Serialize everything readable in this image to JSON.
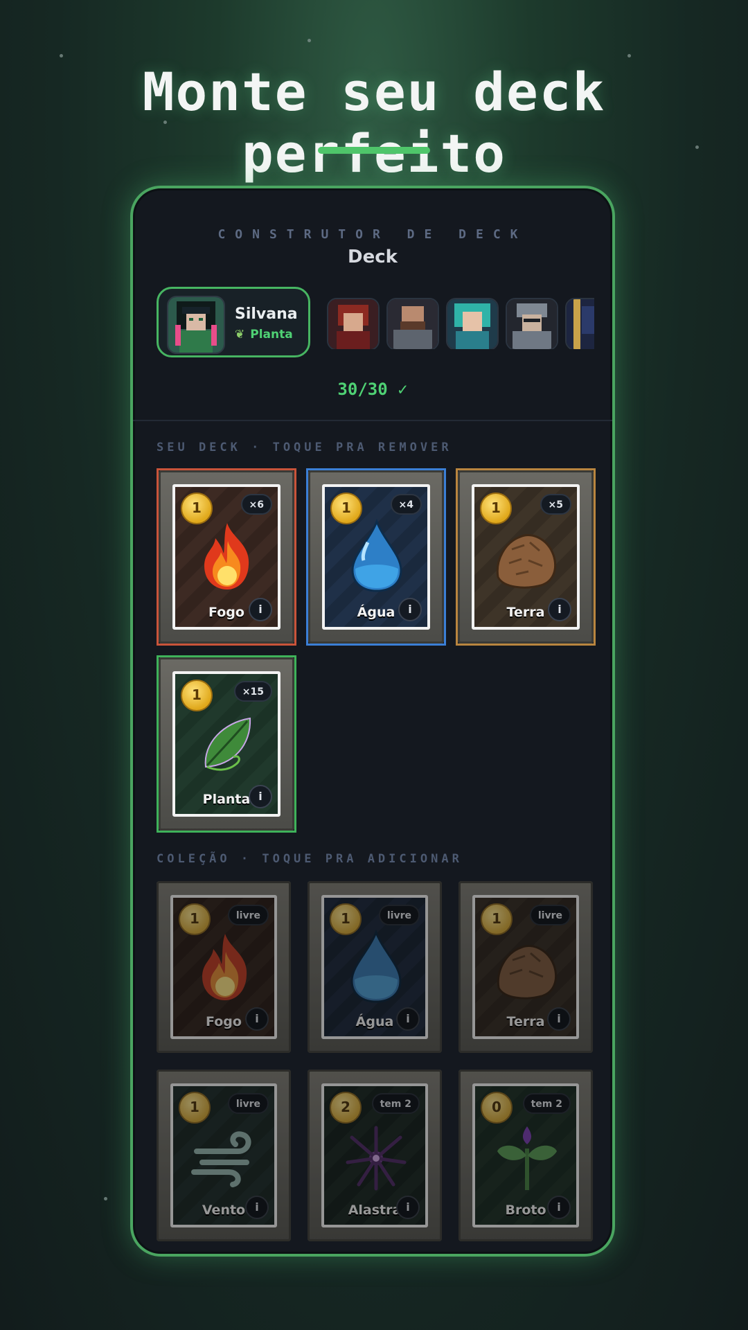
{
  "headline": "Monte seu deck perfeito",
  "screen": {
    "subtitle": "CONSTRUTOR DE DECK",
    "title": "Deck",
    "hero": {
      "name": "Silvana",
      "element": "Planta",
      "element_icon": "leaf-icon"
    },
    "heroes_row": [
      "hero-red-haired",
      "hero-armored-brute",
      "hero-teal-haired",
      "hero-grey-knight",
      "hero-partial"
    ],
    "deck_count": "30/30 ✓",
    "deck_section_label": "SEU DECK · TOQUE PRA REMOVER",
    "collection_section_label": "COLEÇÃO · TOQUE PRA ADICIONAR",
    "deck_cards": [
      {
        "name": "Fogo",
        "cost": "1",
        "badge": "×6",
        "icon": "fire-icon",
        "border": "#c9543a"
      },
      {
        "name": "Água",
        "cost": "1",
        "badge": "×4",
        "icon": "water-drop-icon",
        "border": "#3b7fd6"
      },
      {
        "name": "Terra",
        "cost": "1",
        "badge": "×5",
        "icon": "rock-icon",
        "border": "#b9853f"
      },
      {
        "name": "Planta",
        "cost": "1",
        "badge": "×15",
        "icon": "leaf-icon",
        "border": "#3fb25a"
      }
    ],
    "collection_cards": [
      {
        "name": "Fogo",
        "cost": "1",
        "badge": "livre",
        "icon": "fire-icon"
      },
      {
        "name": "Água",
        "cost": "1",
        "badge": "livre",
        "icon": "water-drop-icon"
      },
      {
        "name": "Terra",
        "cost": "1",
        "badge": "livre",
        "icon": "rock-icon"
      },
      {
        "name": "Vento",
        "cost": "1",
        "badge": "livre",
        "icon": "wind-icon"
      },
      {
        "name": "Alastra",
        "cost": "2",
        "badge": "tem 2",
        "icon": "dark-tendrils-icon"
      },
      {
        "name": "Broto",
        "cost": "0",
        "badge": "tem 2",
        "icon": "sprout-icon"
      }
    ],
    "info_label": "i"
  },
  "colors": {
    "accent": "#4fd174",
    "frame": "#4aa560"
  }
}
